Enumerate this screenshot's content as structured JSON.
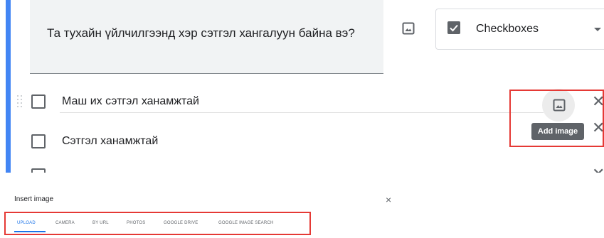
{
  "question": {
    "text": "Та тухайн үйлчилгээнд хэр сэтгэл хангалуун байна вэ?"
  },
  "question_type": {
    "selected": "Checkboxes"
  },
  "options": [
    {
      "label": "Маш их сэтгэл ханамжтай"
    },
    {
      "label": "Сэтгэл ханамжтай"
    }
  ],
  "tooltip": {
    "text": "Add image"
  },
  "icons": {
    "image": "image-icon",
    "close": "close-icon",
    "drag": "drag-handle-icon",
    "dropdown": "caret-down-icon",
    "checkbox": "checkbox-icon"
  },
  "dialog": {
    "title": "Insert image",
    "close_glyph": "×",
    "tabs": [
      {
        "label": "UPLOAD",
        "active": true
      },
      {
        "label": "CAMERA",
        "active": false
      },
      {
        "label": "BY URL",
        "active": false
      },
      {
        "label": "PHOTOS",
        "active": false
      },
      {
        "label": "GOOGLE DRIVE",
        "active": false
      },
      {
        "label": "GOOGLE IMAGE SEARCH",
        "active": false
      }
    ]
  },
  "glyphs": {
    "close": "✕"
  },
  "colors": {
    "accent": "#4285f4",
    "highlight": "#e53935",
    "tab_active": "#1a73e8",
    "tooltip_bg": "#5f6368"
  }
}
